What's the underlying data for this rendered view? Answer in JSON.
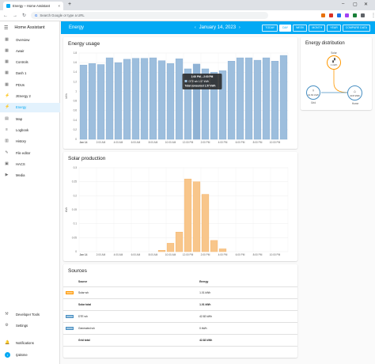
{
  "browser": {
    "tab_title": "Energy – Home Assistant",
    "tab_close": "×",
    "new_tab": "+",
    "win_min": "–",
    "win_max": "▢",
    "win_close": "✕",
    "address_placeholder": "Search Google or type a URL",
    "extension_colors": [
      "#e8710a",
      "#d93025",
      "#1a73e8",
      "#a142f4",
      "#188038",
      "#5f6368"
    ]
  },
  "sidebar": {
    "app_title": "Home Assistant",
    "items": [
      {
        "label": "Overview",
        "icon": "view-dashboard-icon",
        "glyph": "▦"
      },
      {
        "label": "Awair",
        "icon": "dashboard-icon",
        "glyph": "▦"
      },
      {
        "label": "Controls",
        "icon": "dashboard-icon",
        "glyph": "▦"
      },
      {
        "label": "Dash 1",
        "icon": "dashboard-icon",
        "glyph": "▦"
      },
      {
        "label": "PDUs",
        "icon": "dashboard-icon",
        "glyph": "▦"
      },
      {
        "label": "zEnergy 2",
        "icon": "lightning-icon",
        "glyph": "⚡"
      },
      {
        "label": "Energy",
        "icon": "lightning-icon",
        "glyph": "⚡"
      },
      {
        "label": "Map",
        "icon": "map-icon",
        "glyph": "▤"
      },
      {
        "label": "Logbook",
        "icon": "list-icon",
        "glyph": "≡"
      },
      {
        "label": "History",
        "icon": "chart-icon",
        "glyph": "▥"
      },
      {
        "label": "File editor",
        "icon": "wrench-icon",
        "glyph": "✎"
      },
      {
        "label": "HACS",
        "icon": "hacs-icon",
        "glyph": "▣"
      },
      {
        "label": "Media",
        "icon": "media-icon",
        "glyph": "▶"
      }
    ],
    "active_index": 6,
    "bottom": [
      {
        "label": "Developer Tools",
        "icon": "hammer-icon",
        "glyph": "⚒"
      },
      {
        "label": "Settings",
        "icon": "gear-icon",
        "glyph": "⚙"
      },
      {
        "label": "Notifications",
        "icon": "bell-icon",
        "glyph": "🔔"
      }
    ],
    "user": {
      "name": "rjaksme",
      "initial": "r"
    }
  },
  "appbar": {
    "title": "Energy",
    "date": "January 14, 2023",
    "buttons": [
      {
        "label": "TODAY",
        "selected": false
      },
      {
        "label": "DAY",
        "selected": true
      },
      {
        "label": "WEEK",
        "selected": false
      },
      {
        "label": "MONTH",
        "selected": false
      },
      {
        "label": "YEAR",
        "selected": false
      },
      {
        "label": "COMPARE DATA",
        "selected": false
      }
    ]
  },
  "energy_usage": {
    "title": "Energy usage",
    "tooltip": {
      "time": "1:00 PM – 2:00 PM",
      "line1": "DTE wh 1.57 kWh",
      "line2": "Total consumed 1.57 kWh"
    }
  },
  "solar": {
    "title": "Solar production"
  },
  "distribution": {
    "title": "Energy distribution",
    "solar": {
      "label": "Solar",
      "value": "1 kWh"
    },
    "grid": {
      "label": "Grid",
      "value": "42.82 kWh"
    },
    "home": {
      "label": "Home",
      "value": "43.8 kWh"
    }
  },
  "sources": {
    "title": "Sources",
    "col_source": "Source",
    "col_energy": "Energy",
    "rows": [
      {
        "name": "Solar wh",
        "value": "1.01 kWh",
        "color": "#ff9800",
        "total": false
      },
      {
        "name": "Solar total",
        "value": "1.01 kWh",
        "color": "",
        "total": true
      },
      {
        "name": "DTE wh",
        "value": "42.82 kWh",
        "color": "#488fc2",
        "total": false
      },
      {
        "name": "Generated wh",
        "value": "0 kWh",
        "color": "#488fc2",
        "total": false
      },
      {
        "name": "Grid total",
        "value": "42.82 kWh",
        "color": "",
        "total": true
      }
    ]
  },
  "chart_data": [
    {
      "type": "bar",
      "title": "Energy usage",
      "ylabel": "kWh",
      "ylim": [
        0,
        1.8
      ],
      "yticks": [
        0,
        0.2,
        0.4,
        0.6,
        0.8,
        1,
        1.2,
        1.4,
        1.6,
        1.8
      ],
      "x_tick_labels": [
        "Jan 14",
        "2:00 AM",
        "4:00 AM",
        "6:00 AM",
        "8:00 AM",
        "10:00 AM",
        "12:00 PM",
        "2:00 PM",
        "4:00 PM",
        "6:00 PM",
        "8:00 PM",
        "10:00 PM"
      ],
      "x": [
        "00",
        "01",
        "02",
        "03",
        "04",
        "05",
        "06",
        "07",
        "08",
        "09",
        "10",
        "11",
        "12",
        "13",
        "14",
        "15",
        "16",
        "17",
        "18",
        "19",
        "20",
        "21",
        "22",
        "23"
      ],
      "series": [
        {
          "name": "DTE wh",
          "color": "#9dbedd",
          "values": [
            1.55,
            1.58,
            1.56,
            1.7,
            1.6,
            1.67,
            1.69,
            1.69,
            1.7,
            1.64,
            1.58,
            1.68,
            1.47,
            1.57,
            1.47,
            1.4,
            1.43,
            1.63,
            1.7,
            1.7,
            1.65,
            1.7,
            1.63,
            1.75
          ]
        }
      ],
      "highlight_index": 13,
      "grid": true
    },
    {
      "type": "bar",
      "title": "Solar production",
      "ylabel": "kWh",
      "ylim": [
        0,
        0.3
      ],
      "yticks": [
        0,
        0.05,
        0.1,
        0.15,
        0.2,
        0.25,
        0.3
      ],
      "x_tick_labels": [
        "Jan 14",
        "2:00 AM",
        "4:00 AM",
        "6:00 AM",
        "8:00 AM",
        "10:00 AM",
        "12:00 PM",
        "2:00 PM",
        "4:00 PM",
        "6:00 PM",
        "8:00 PM",
        "10:00 PM"
      ],
      "x": [
        "00",
        "01",
        "02",
        "03",
        "04",
        "05",
        "06",
        "07",
        "08",
        "09",
        "10",
        "11",
        "12",
        "13",
        "14",
        "15",
        "16",
        "17",
        "18",
        "19",
        "20",
        "21",
        "22",
        "23"
      ],
      "series": [
        {
          "name": "Solar wh",
          "color": "#f8c68b",
          "values": [
            0,
            0,
            0,
            0,
            0,
            0,
            0,
            0,
            0,
            0.005,
            0.03,
            0.07,
            0.26,
            0.25,
            0.205,
            0.04,
            0.01,
            0,
            0,
            0,
            0,
            0,
            0,
            0
          ]
        }
      ],
      "grid": true
    }
  ]
}
